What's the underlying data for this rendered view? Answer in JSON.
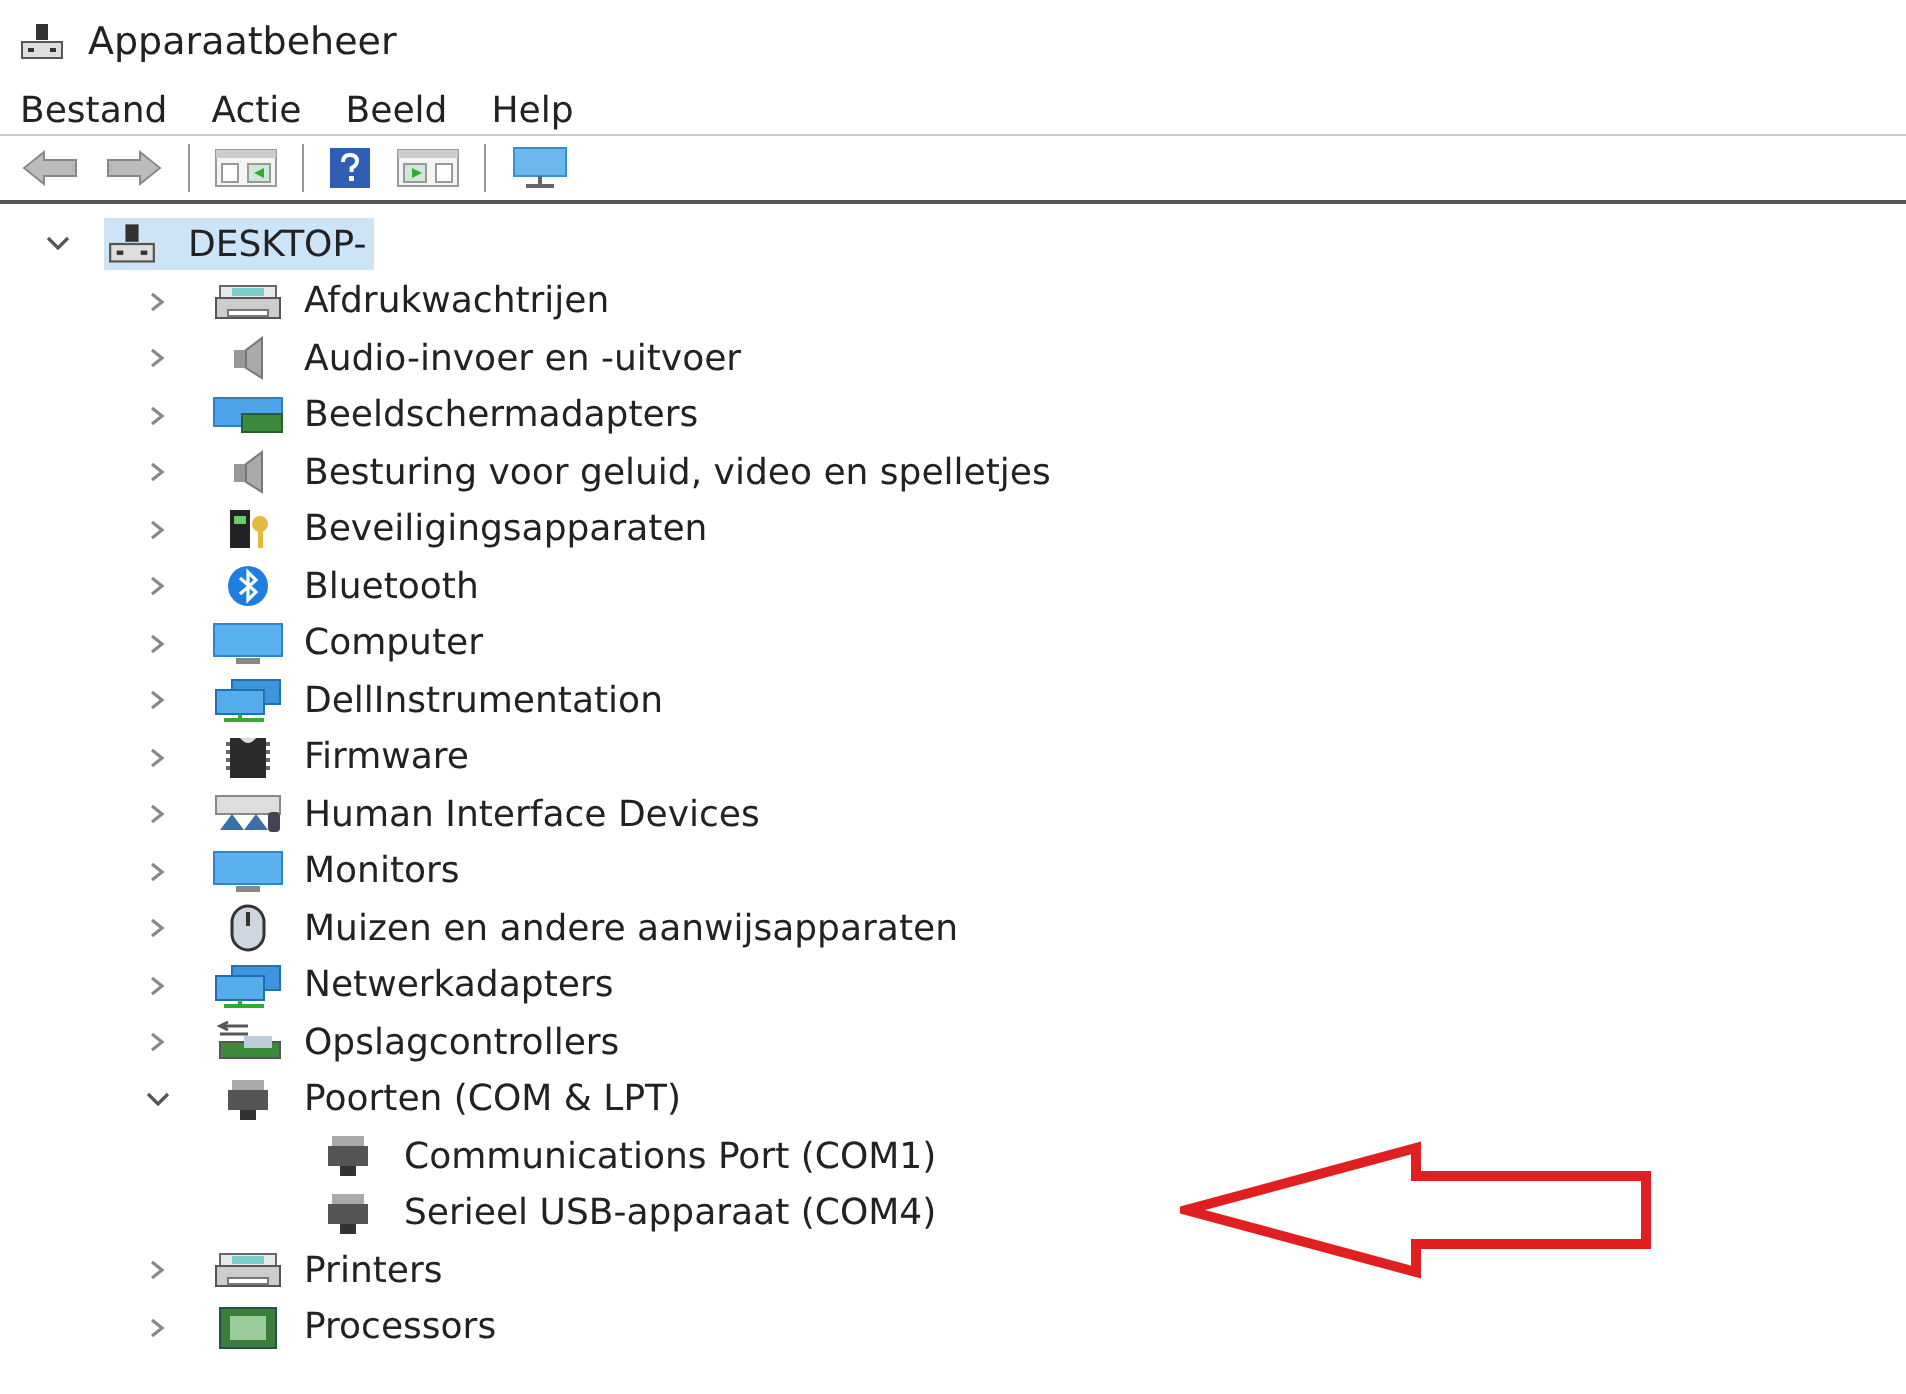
{
  "window": {
    "title": "Apparaatbeheer"
  },
  "menu": [
    "Bestand",
    "Actie",
    "Beeld",
    "Help"
  ],
  "tree": {
    "label": "DESKTOP-",
    "expanded": true,
    "selected": true,
    "children": [
      {
        "label": "Afdrukwachtrijen",
        "kind": "printer",
        "expanded": false
      },
      {
        "label": "Audio-invoer en -uitvoer",
        "kind": "speaker",
        "expanded": false
      },
      {
        "label": "Beeldschermadapters",
        "kind": "display",
        "expanded": false
      },
      {
        "label": "Besturing voor geluid, video en spelletjes",
        "kind": "speaker",
        "expanded": false
      },
      {
        "label": "Beveiligingsapparaten",
        "kind": "security",
        "expanded": false
      },
      {
        "label": "Bluetooth",
        "kind": "bluetooth",
        "expanded": false
      },
      {
        "label": "Computer",
        "kind": "monitor",
        "expanded": false
      },
      {
        "label": "DellInstrumentation",
        "kind": "network",
        "expanded": false
      },
      {
        "label": "Firmware",
        "kind": "chip",
        "expanded": false
      },
      {
        "label": "Human Interface Devices",
        "kind": "hid",
        "expanded": false
      },
      {
        "label": "Monitors",
        "kind": "monitor",
        "expanded": false
      },
      {
        "label": "Muizen en andere aanwijsapparaten",
        "kind": "mouse",
        "expanded": false
      },
      {
        "label": "Netwerkadapters",
        "kind": "network",
        "expanded": false
      },
      {
        "label": "Opslagcontrollers",
        "kind": "storage",
        "expanded": false
      },
      {
        "label": "Poorten (COM & LPT)",
        "kind": "port",
        "expanded": true,
        "children": [
          {
            "label": "Communications Port (COM1)",
            "kind": "port"
          },
          {
            "label": "Serieel USB-apparaat (COM4)",
            "kind": "port"
          }
        ]
      },
      {
        "label": "Printers",
        "kind": "printer",
        "expanded": false
      },
      {
        "label": "Processors",
        "kind": "processor",
        "expanded": false
      }
    ]
  }
}
